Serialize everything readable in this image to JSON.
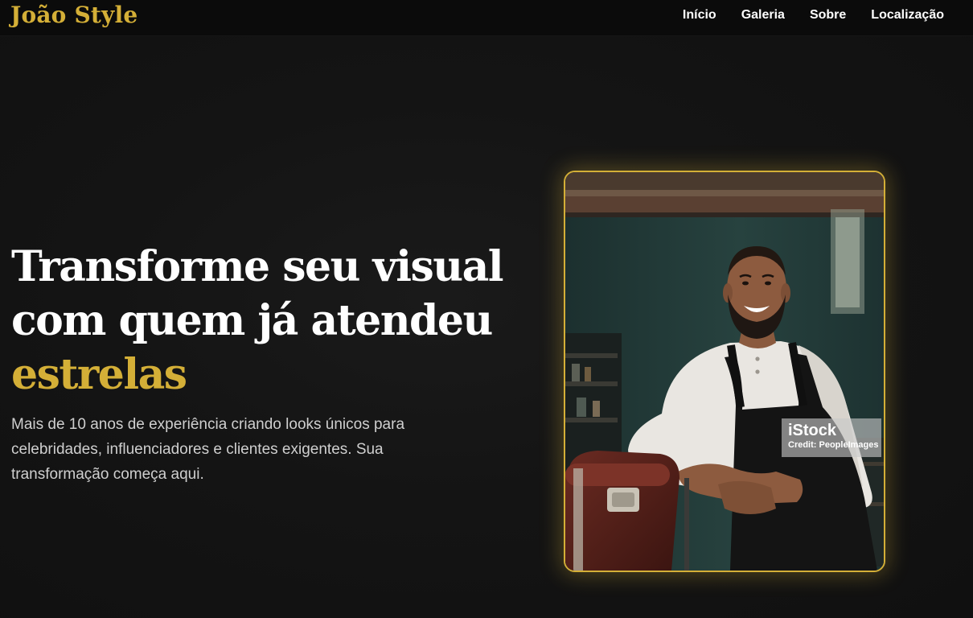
{
  "header": {
    "brand": "João Style",
    "nav": [
      "Início",
      "Galeria",
      "Sobre",
      "Localização"
    ]
  },
  "hero": {
    "headline_main": "Transforme seu visual com quem já atendeu ",
    "headline_accent": "estrelas",
    "subtext": "Mais de 10 anos de experiência criando looks únicos para celebridades, influenciadores e clientes exigentes. Sua transformação começa aqui.",
    "image": {
      "subject": "smiling bearded barber in white henley shirt and black apron leaning on a barber chair",
      "watermark_brand": "iStock",
      "watermark_credit": "Credit: PeopleImages"
    }
  },
  "colors": {
    "accent": "#d4af37",
    "background": "#121212",
    "topbar": "#0b0b0b",
    "text": "#ffffff",
    "muted_text": "#cfcfcf"
  }
}
